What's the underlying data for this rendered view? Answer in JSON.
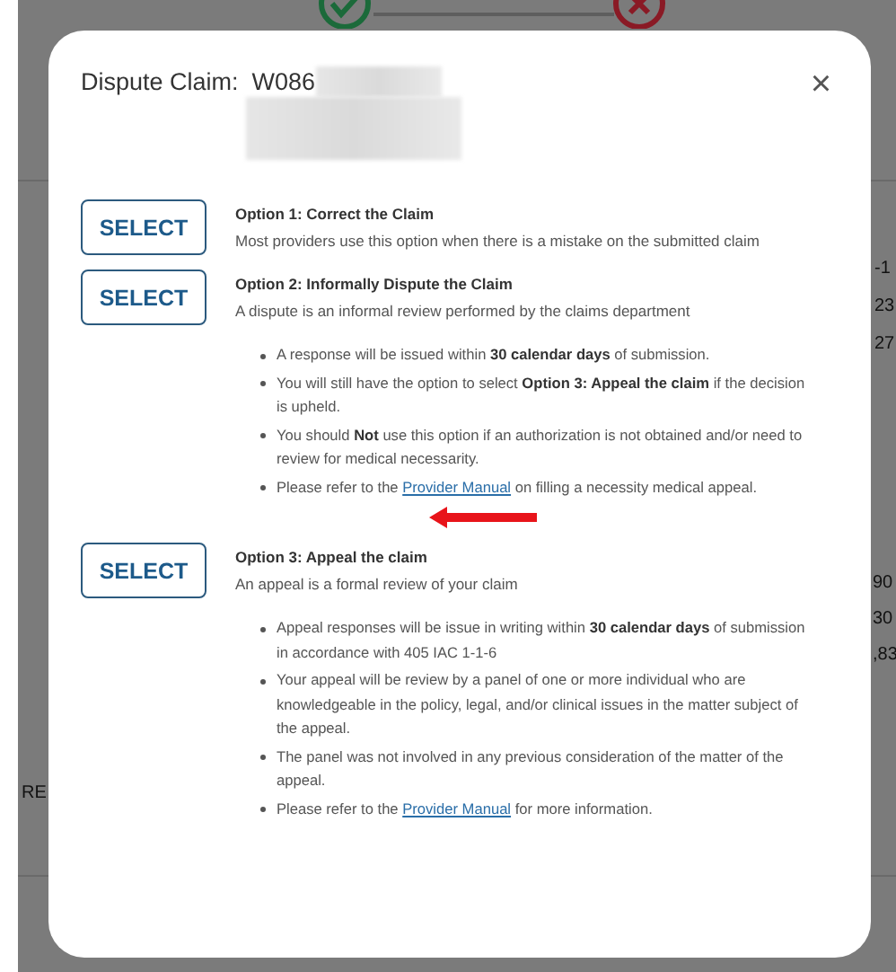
{
  "background": {
    "right_upper": [
      "-1",
      "23",
      "27"
    ],
    "right_lower": [
      "90",
      "30",
      ",83"
    ],
    "left": [
      "RE"
    ]
  },
  "dialog": {
    "title": "Dispute Claim:  W086",
    "close": "×",
    "options": [
      {
        "button": "SELECT",
        "title": "Option 1: Correct the Claim",
        "description": "Most providers use this option when there is a mistake on the submitted claim"
      },
      {
        "button": "SELECT",
        "title": "Option 2: Informally Dispute the Claim",
        "description": "A dispute is an informal review performed by the claims department",
        "annotated": true,
        "bullets": [
          {
            "before": "A response will be issued within **30 calendar days** of submission."
          },
          {
            "before": "You will still have the option to select **Option 3: Appeal the claim** if the decision is upheld."
          },
          {
            "before": "You should **Not** use this option if an authorization is not obtained and/or need to review for medical necessarity."
          },
          {
            "before": "Please refer to the ",
            "link": "Provider Manual",
            "after": " on filling a necessity medical appeal."
          }
        ]
      },
      {
        "button": "SELECT",
        "title": "Option 3: Appeal the claim",
        "description": "An appeal is a formal review of your claim",
        "bullets": [
          {
            "before": "Appeal responses will be issue in writing within **30 calendar days** of submission in accordance with 405 IAC 1-1-6"
          },
          {
            "before": "Your appeal will be review by a panel of one or more individual who are knowledgeable in the policy, legal, and/or clinical issues in the matter subject of the appeal."
          },
          {
            "before": "The panel was not involved in any previous consideration of the matter of the appeal."
          },
          {
            "before": "Please refer to the ",
            "link": "Provider Manual",
            "after": " for more information."
          }
        ]
      }
    ]
  }
}
